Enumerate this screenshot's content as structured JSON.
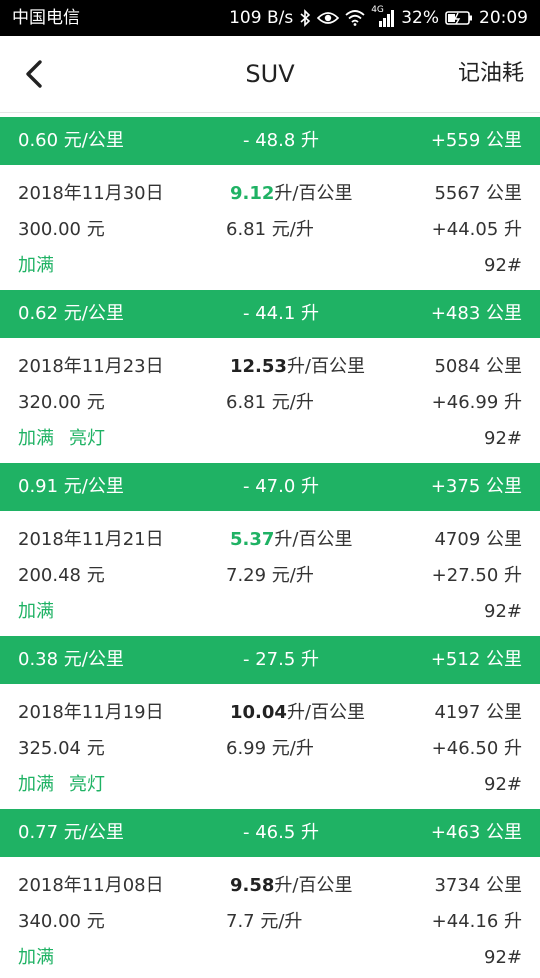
{
  "status_bar": {
    "carrier": "中国电信",
    "speed": "109 B/s",
    "network": "4G",
    "battery": "32%",
    "time": "20:09"
  },
  "header": {
    "title": "SUV",
    "action": "记油耗"
  },
  "colors": {
    "accent": "#1fb264"
  },
  "records": [
    {
      "summary": {
        "cost_per_km": "0.60 元/公里",
        "fuel_diff": "- 48.8 升",
        "distance_diff": "+559 公里"
      },
      "date": "2018年11月30日",
      "efficiency_value": "9.12",
      "efficiency_unit": "升/百公里",
      "efficiency_highlight": true,
      "odometer": "5567 公里",
      "amount": "300.00 元",
      "price": "6.81 元/升",
      "volume": "+44.05 升",
      "tags": [
        "加满"
      ],
      "grade": "92#"
    },
    {
      "summary": {
        "cost_per_km": "0.62 元/公里",
        "fuel_diff": "- 44.1 升",
        "distance_diff": "+483 公里"
      },
      "date": "2018年11月23日",
      "efficiency_value": "12.53",
      "efficiency_unit": "升/百公里",
      "efficiency_highlight": false,
      "odometer": "5084 公里",
      "amount": "320.00 元",
      "price": "6.81 元/升",
      "volume": "+46.99 升",
      "tags": [
        "加满",
        "亮灯"
      ],
      "grade": "92#"
    },
    {
      "summary": {
        "cost_per_km": "0.91 元/公里",
        "fuel_diff": "- 47.0 升",
        "distance_diff": "+375 公里"
      },
      "date": "2018年11月21日",
      "efficiency_value": "5.37",
      "efficiency_unit": "升/百公里",
      "efficiency_highlight": true,
      "odometer": "4709 公里",
      "amount": "200.48 元",
      "price": "7.29 元/升",
      "volume": "+27.50 升",
      "tags": [
        "加满"
      ],
      "grade": "92#"
    },
    {
      "summary": {
        "cost_per_km": "0.38 元/公里",
        "fuel_diff": "- 27.5 升",
        "distance_diff": "+512 公里"
      },
      "date": "2018年11月19日",
      "efficiency_value": "10.04",
      "efficiency_unit": "升/百公里",
      "efficiency_highlight": false,
      "odometer": "4197 公里",
      "amount": "325.04 元",
      "price": "6.99 元/升",
      "volume": "+46.50 升",
      "tags": [
        "加满",
        "亮灯"
      ],
      "grade": "92#"
    },
    {
      "summary": {
        "cost_per_km": "0.77 元/公里",
        "fuel_diff": "- 46.5 升",
        "distance_diff": "+463 公里"
      },
      "date": "2018年11月08日",
      "efficiency_value": "9.58",
      "efficiency_unit": "升/百公里",
      "efficiency_highlight": false,
      "odometer": "3734 公里",
      "amount": "340.00 元",
      "price": "7.7 元/升",
      "volume": "+44.16 升",
      "tags": [
        "加满"
      ],
      "grade": "92#"
    }
  ]
}
